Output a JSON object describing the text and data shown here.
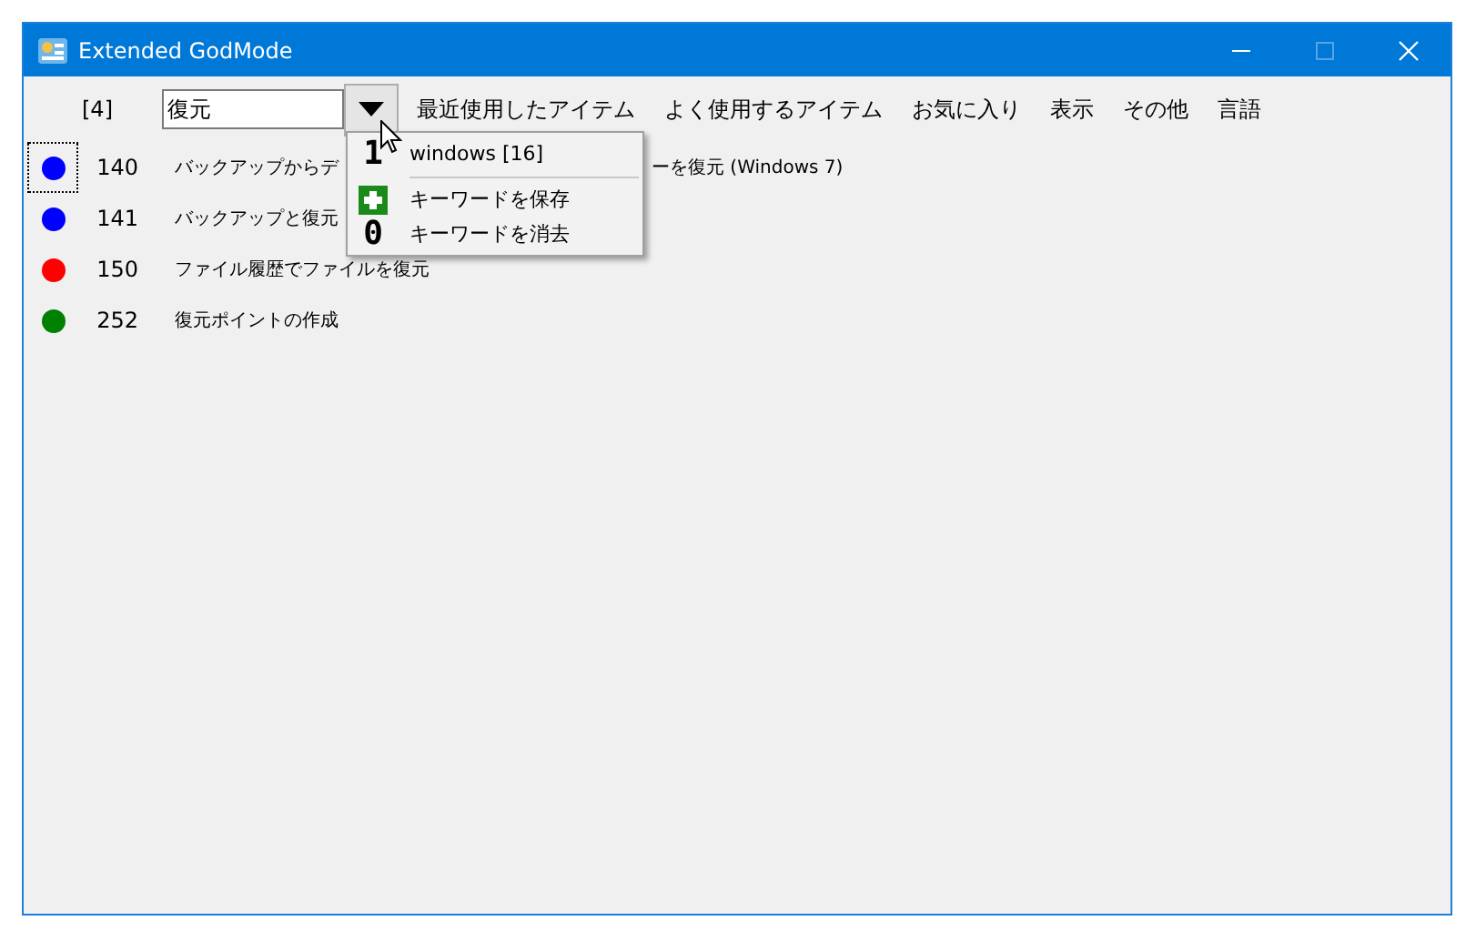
{
  "window": {
    "title": "Extended GodMode"
  },
  "toolbar": {
    "count": "[4]",
    "search": {
      "value": "復元"
    },
    "menus": [
      "最近使用したアイテム",
      "よく使用するアイテム",
      "お気に入り",
      "表示",
      "その他",
      "言語"
    ]
  },
  "dropdown": {
    "items": [
      {
        "kind": "digit",
        "glyph": "1",
        "label": "windows [16]"
      },
      {
        "kind": "separator"
      },
      {
        "kind": "plus",
        "label": "キーワードを保存"
      },
      {
        "kind": "digit",
        "glyph": "0",
        "label": "キーワードを消去"
      }
    ]
  },
  "rows": [
    {
      "color": "#0000ff",
      "number": "140",
      "text_parts": [
        "バックアップからデ",
        "ーを復元 (Windows 7)"
      ],
      "focused": true
    },
    {
      "color": "#0000ff",
      "number": "141",
      "text_parts": [
        "バックアップと復元"
      ],
      "focused": false
    },
    {
      "color": "#ff0000",
      "number": "150",
      "text_parts": [
        "ファイル履歴でファイルを復元"
      ],
      "focused": false
    },
    {
      "color": "#008000",
      "number": "252",
      "text_parts": [
        "復元ポイントの作成"
      ],
      "focused": false
    }
  ]
}
